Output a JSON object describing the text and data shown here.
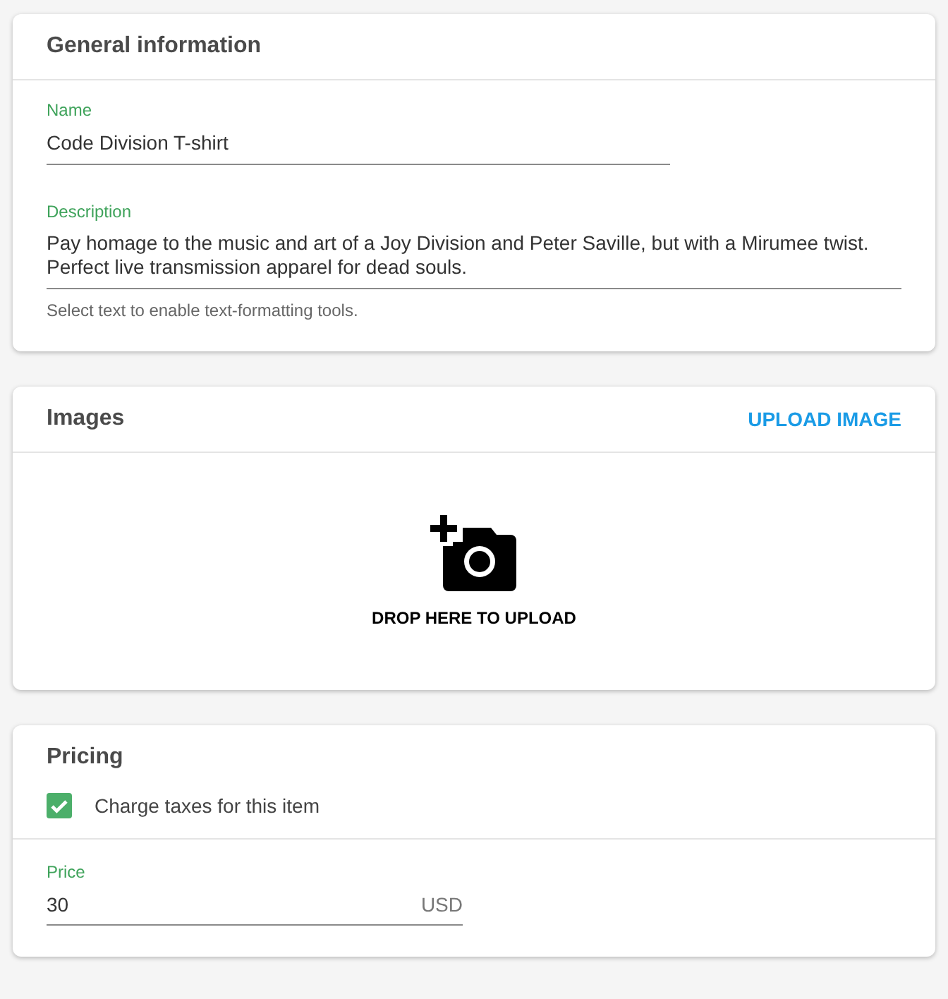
{
  "general": {
    "title": "General information",
    "name_field": {
      "label": "Name",
      "value": "Code Division T-shirt"
    },
    "description_field": {
      "label": "Description",
      "value": "Pay homage to the music and art of a Joy Division and Peter Saville, but with a Mirumee twist. Perfect live transmission apparel for dead souls.",
      "helper": "Select text to enable text-formatting tools."
    }
  },
  "images": {
    "title": "Images",
    "action": "UPLOAD IMAGE",
    "dropzone": "DROP HERE TO UPLOAD"
  },
  "pricing": {
    "title": "Pricing",
    "taxes": {
      "label": "Charge taxes for this item",
      "checked": true
    },
    "price_field": {
      "label": "Price",
      "value": "30",
      "currency": "USD"
    }
  }
}
